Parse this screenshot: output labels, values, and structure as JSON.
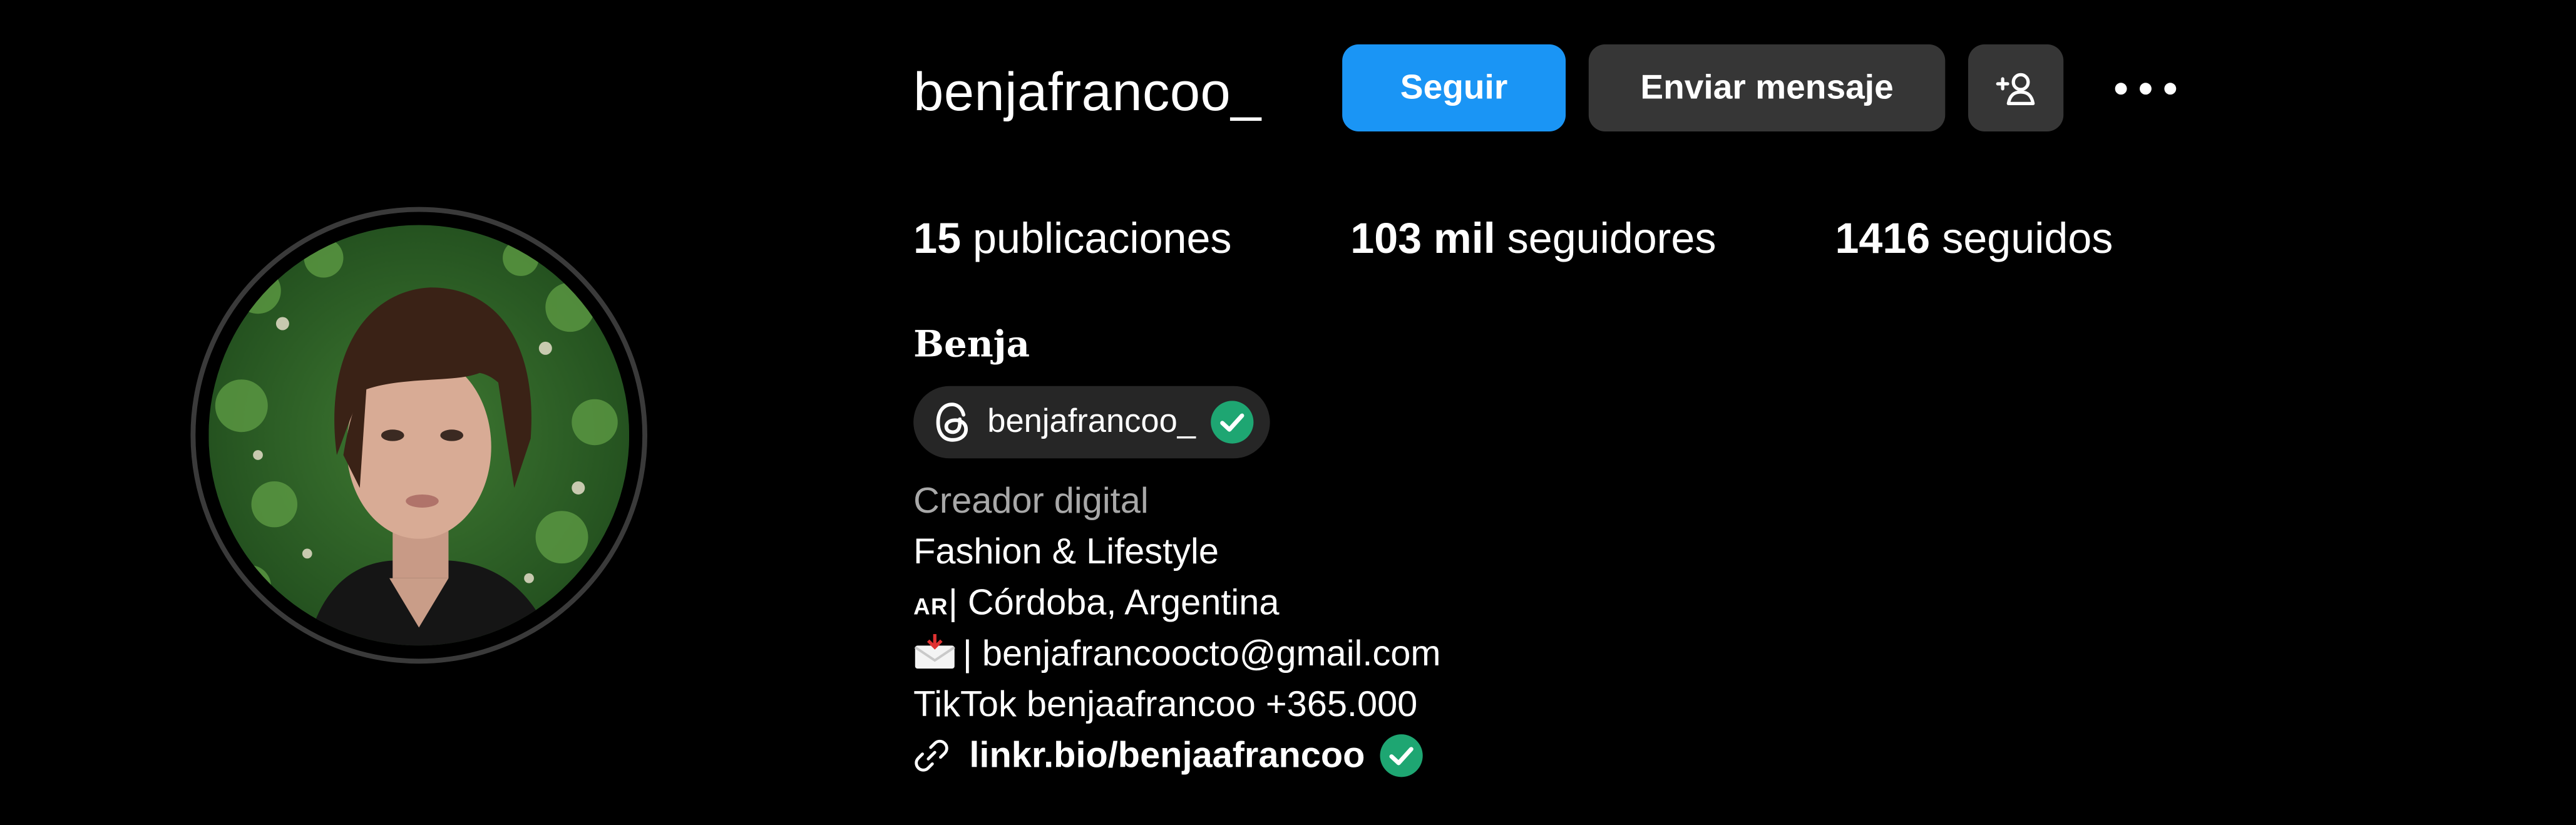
{
  "profile": {
    "username": "benjafrancoo_",
    "full_name": "Benja",
    "avatar_alt": "profile-photo"
  },
  "actions": {
    "follow_label": "Seguir",
    "message_label": "Enviar mensaje",
    "suggest_icon": "add-person-icon",
    "more_icon": "more-options-icon"
  },
  "stats": {
    "posts_count": "15",
    "posts_label": "publicaciones",
    "followers_count": "103 mil",
    "followers_label": "seguidores",
    "following_count": "1416",
    "following_label": "seguidos"
  },
  "threads": {
    "handle": "benjafrancoo_",
    "icon": "threads-icon",
    "verified_icon": "verified-badge-icon"
  },
  "bio": {
    "category": "Creador digital",
    "line1": "Fashion & Lifestyle",
    "flag_text": "AR",
    "line2_text": "| Córdoba, Argentina",
    "line3_text": "| benjafrancoocto@gmail.com",
    "line4": "TikTok benjaafrancoo +365.000",
    "link": "linkr.bio/benjaafrancoo"
  },
  "colors": {
    "background": "#000000",
    "follow_button": "#1a95f5",
    "secondary_button": "#363636",
    "badge_bg": "#262626",
    "muted_text": "#a8a8a8",
    "verified": "#1ea672"
  }
}
